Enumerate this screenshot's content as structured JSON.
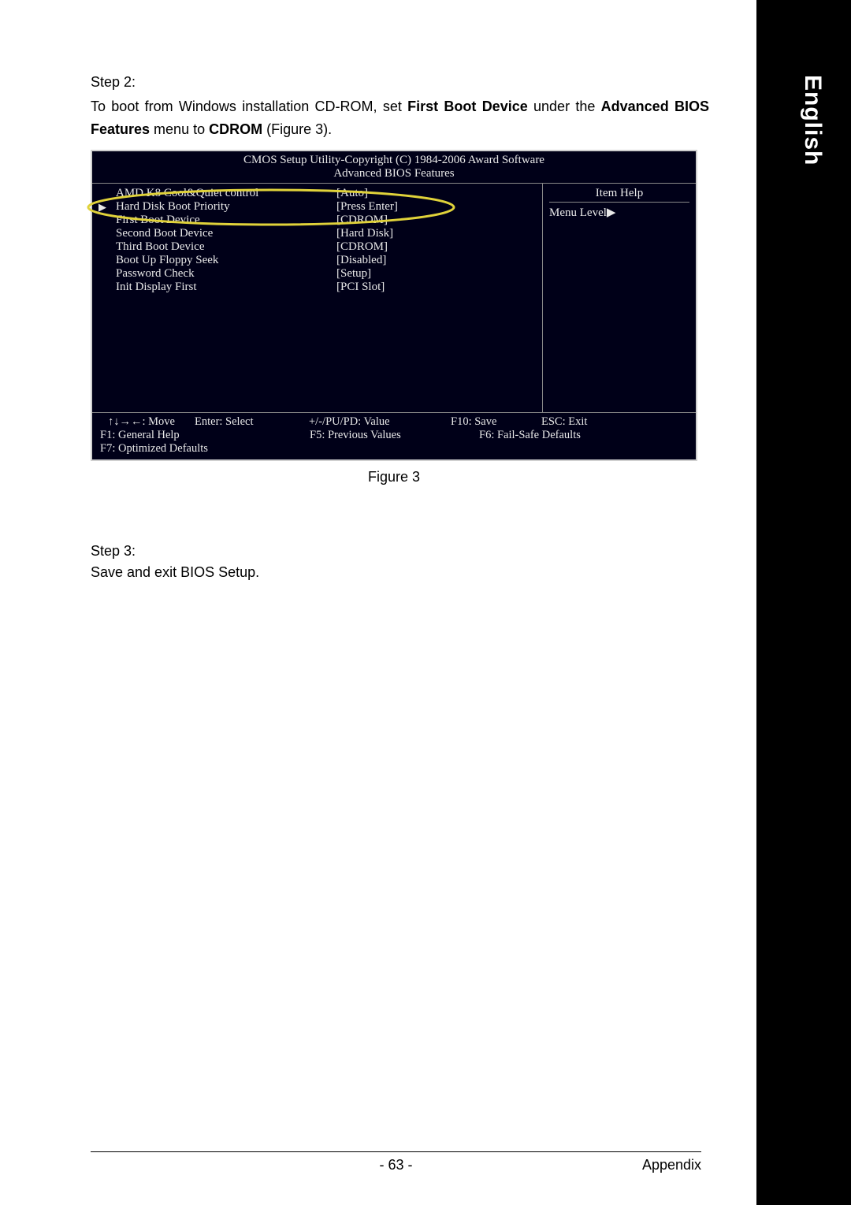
{
  "side_label": "English",
  "step2": {
    "title": "Step 2:",
    "line_pre": "To boot from Windows installation CD-ROM, set ",
    "bold1": "First Boot Device",
    "mid1": " under the ",
    "bold2": "Advanced BIOS Features",
    "mid2": " menu to ",
    "bold3": "CDROM",
    "end": " (Figure 3)."
  },
  "bios": {
    "title1": "CMOS Setup Utility-Copyright (C) 1984-2006 Award Software",
    "title2": "Advanced BIOS Features",
    "rows": [
      {
        "label": "AMD K8 Cool&Quiet control",
        "value": "[Auto]"
      },
      {
        "label": "Hard Disk Boot Priority",
        "value": "[Press Enter]"
      },
      {
        "label": "First Boot Device",
        "value": "[CDROM]"
      },
      {
        "label": "Second Boot Device",
        "value": "[Hard Disk]"
      },
      {
        "label": "Third Boot Device",
        "value": "[CDROM]"
      },
      {
        "label": "Boot Up Floppy Seek",
        "value": "[Disabled]"
      },
      {
        "label": "Password Check",
        "value": "[Setup]"
      },
      {
        "label": "Init Display First",
        "value": "[PCI Slot]"
      }
    ],
    "help_title": "Item Help",
    "menu_level": "Menu Level",
    "footer": {
      "f1": "↑↓→←: Move",
      "f2": "Enter: Select",
      "f3": "+/-/PU/PD: Value",
      "f4": "F10: Save",
      "f5": "ESC: Exit",
      "f6": "F1: General Help",
      "f7": "F5: Previous Values",
      "f8": "F6: Fail-Safe Defaults",
      "f9": "F7: Optimized Defaults"
    }
  },
  "figure_caption": "Figure 3",
  "step3": {
    "title": "Step 3:",
    "body": "Save and exit BIOS Setup."
  },
  "footer": {
    "page": "- 63 -",
    "section": "Appendix"
  }
}
